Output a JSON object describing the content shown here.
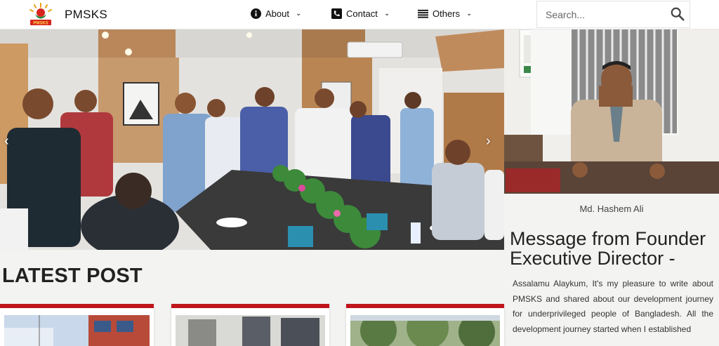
{
  "header": {
    "brand": "PMSKS",
    "logo_text": "PMSKS",
    "nav": [
      {
        "label": "About",
        "icon": "info-icon"
      },
      {
        "label": "Contact",
        "icon": "phone-icon"
      },
      {
        "label": "Others",
        "icon": "menu-icon"
      }
    ],
    "search": {
      "placeholder": "Search...",
      "value": ""
    }
  },
  "founder": {
    "name": "Md. Hashem Ali",
    "title": "Message from Founder Executive Director -",
    "body": "Assalamu Alaykum, It's my pleasure to write about PMSKS and shared about our development journey for underprivileged people of Bangladesh. All the development journey started when I established"
  },
  "latest": {
    "title": "LATEST POST"
  },
  "colors": {
    "accent": "#c0141b",
    "background": "#f3f3f1"
  }
}
